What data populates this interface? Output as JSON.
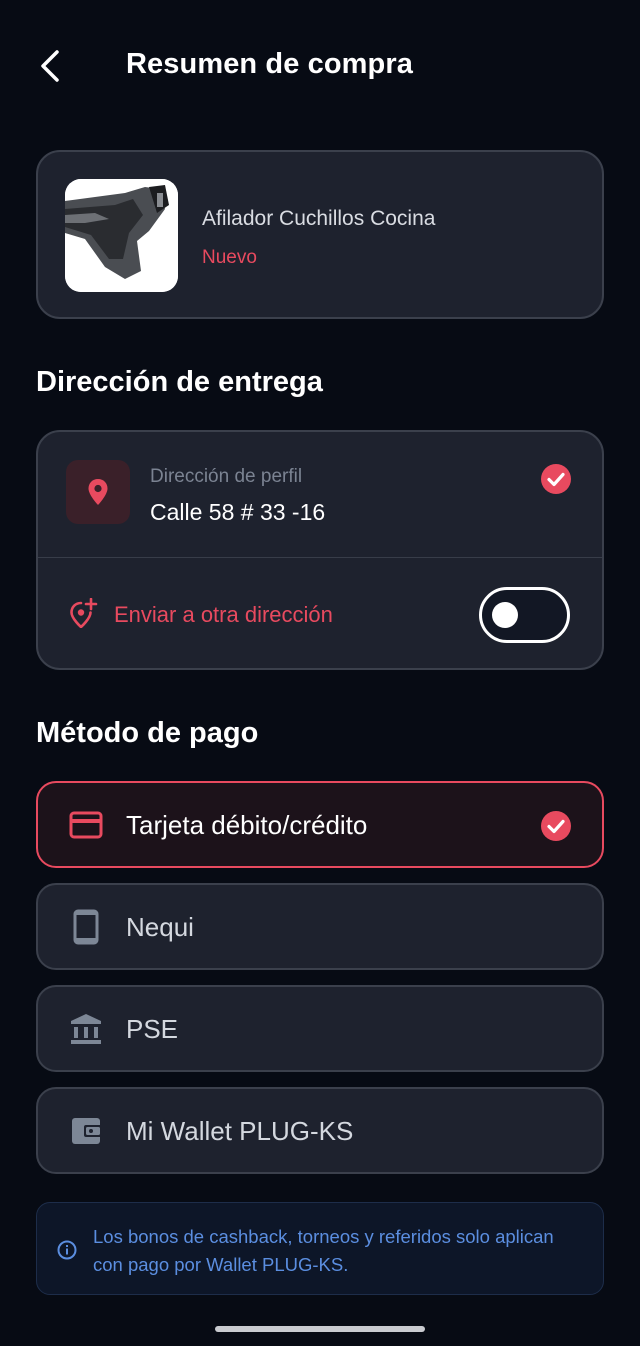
{
  "header": {
    "title": "Resumen de compra"
  },
  "product": {
    "name": "Afilador Cuchillos Cocina",
    "condition": "Nuevo"
  },
  "delivery": {
    "section_title": "Dirección de entrega",
    "profile_label": "Dirección de perfil",
    "profile_address": "Calle 58 # 33 -16",
    "other_address_label": "Enviar a otra dirección",
    "other_address_enabled": false
  },
  "payment": {
    "section_title": "Método de pago",
    "methods": [
      {
        "label": "Tarjeta débito/crédito",
        "icon": "credit-card-icon",
        "selected": true
      },
      {
        "label": "Nequi",
        "icon": "phone-icon",
        "selected": false
      },
      {
        "label": "PSE",
        "icon": "bank-icon",
        "selected": false
      },
      {
        "label": "Mi Wallet PLUG-KS",
        "icon": "wallet-icon",
        "selected": false
      }
    ]
  },
  "info_note": "Los bonos de cashback, torneos y referidos solo aplican con pago por Wallet PLUG-KS.",
  "colors": {
    "accent": "#e84a5f",
    "background": "#070b14",
    "card": "#1e222e",
    "info": "#5b8ee0"
  }
}
